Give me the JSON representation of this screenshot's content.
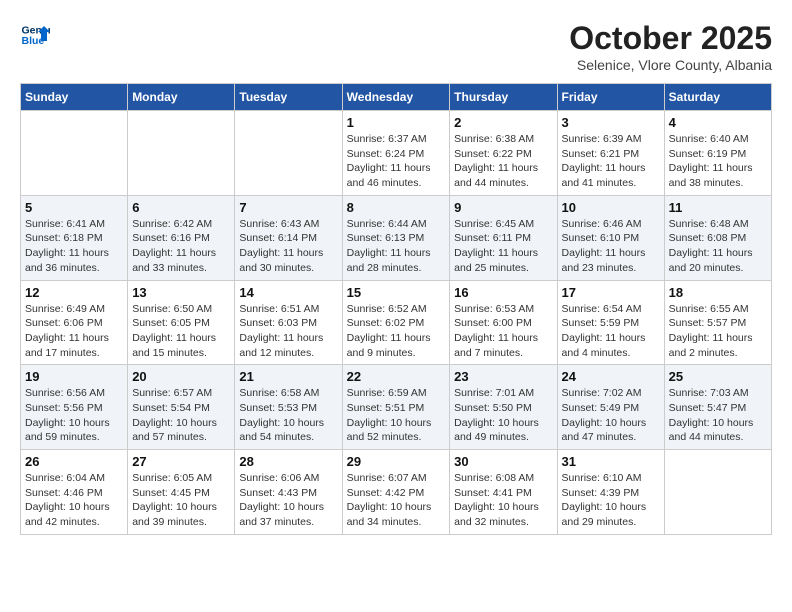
{
  "header": {
    "logo_line1": "General",
    "logo_line2": "Blue",
    "month_title": "October 2025",
    "location": "Selenice, Vlore County, Albania"
  },
  "days_of_week": [
    "Sunday",
    "Monday",
    "Tuesday",
    "Wednesday",
    "Thursday",
    "Friday",
    "Saturday"
  ],
  "weeks": [
    [
      {
        "day": "",
        "info": ""
      },
      {
        "day": "",
        "info": ""
      },
      {
        "day": "",
        "info": ""
      },
      {
        "day": "1",
        "info": "Sunrise: 6:37 AM\nSunset: 6:24 PM\nDaylight: 11 hours\nand 46 minutes."
      },
      {
        "day": "2",
        "info": "Sunrise: 6:38 AM\nSunset: 6:22 PM\nDaylight: 11 hours\nand 44 minutes."
      },
      {
        "day": "3",
        "info": "Sunrise: 6:39 AM\nSunset: 6:21 PM\nDaylight: 11 hours\nand 41 minutes."
      },
      {
        "day": "4",
        "info": "Sunrise: 6:40 AM\nSunset: 6:19 PM\nDaylight: 11 hours\nand 38 minutes."
      }
    ],
    [
      {
        "day": "5",
        "info": "Sunrise: 6:41 AM\nSunset: 6:18 PM\nDaylight: 11 hours\nand 36 minutes."
      },
      {
        "day": "6",
        "info": "Sunrise: 6:42 AM\nSunset: 6:16 PM\nDaylight: 11 hours\nand 33 minutes."
      },
      {
        "day": "7",
        "info": "Sunrise: 6:43 AM\nSunset: 6:14 PM\nDaylight: 11 hours\nand 30 minutes."
      },
      {
        "day": "8",
        "info": "Sunrise: 6:44 AM\nSunset: 6:13 PM\nDaylight: 11 hours\nand 28 minutes."
      },
      {
        "day": "9",
        "info": "Sunrise: 6:45 AM\nSunset: 6:11 PM\nDaylight: 11 hours\nand 25 minutes."
      },
      {
        "day": "10",
        "info": "Sunrise: 6:46 AM\nSunset: 6:10 PM\nDaylight: 11 hours\nand 23 minutes."
      },
      {
        "day": "11",
        "info": "Sunrise: 6:48 AM\nSunset: 6:08 PM\nDaylight: 11 hours\nand 20 minutes."
      }
    ],
    [
      {
        "day": "12",
        "info": "Sunrise: 6:49 AM\nSunset: 6:06 PM\nDaylight: 11 hours\nand 17 minutes."
      },
      {
        "day": "13",
        "info": "Sunrise: 6:50 AM\nSunset: 6:05 PM\nDaylight: 11 hours\nand 15 minutes."
      },
      {
        "day": "14",
        "info": "Sunrise: 6:51 AM\nSunset: 6:03 PM\nDaylight: 11 hours\nand 12 minutes."
      },
      {
        "day": "15",
        "info": "Sunrise: 6:52 AM\nSunset: 6:02 PM\nDaylight: 11 hours\nand 9 minutes."
      },
      {
        "day": "16",
        "info": "Sunrise: 6:53 AM\nSunset: 6:00 PM\nDaylight: 11 hours\nand 7 minutes."
      },
      {
        "day": "17",
        "info": "Sunrise: 6:54 AM\nSunset: 5:59 PM\nDaylight: 11 hours\nand 4 minutes."
      },
      {
        "day": "18",
        "info": "Sunrise: 6:55 AM\nSunset: 5:57 PM\nDaylight: 11 hours\nand 2 minutes."
      }
    ],
    [
      {
        "day": "19",
        "info": "Sunrise: 6:56 AM\nSunset: 5:56 PM\nDaylight: 10 hours\nand 59 minutes."
      },
      {
        "day": "20",
        "info": "Sunrise: 6:57 AM\nSunset: 5:54 PM\nDaylight: 10 hours\nand 57 minutes."
      },
      {
        "day": "21",
        "info": "Sunrise: 6:58 AM\nSunset: 5:53 PM\nDaylight: 10 hours\nand 54 minutes."
      },
      {
        "day": "22",
        "info": "Sunrise: 6:59 AM\nSunset: 5:51 PM\nDaylight: 10 hours\nand 52 minutes."
      },
      {
        "day": "23",
        "info": "Sunrise: 7:01 AM\nSunset: 5:50 PM\nDaylight: 10 hours\nand 49 minutes."
      },
      {
        "day": "24",
        "info": "Sunrise: 7:02 AM\nSunset: 5:49 PM\nDaylight: 10 hours\nand 47 minutes."
      },
      {
        "day": "25",
        "info": "Sunrise: 7:03 AM\nSunset: 5:47 PM\nDaylight: 10 hours\nand 44 minutes."
      }
    ],
    [
      {
        "day": "26",
        "info": "Sunrise: 6:04 AM\nSunset: 4:46 PM\nDaylight: 10 hours\nand 42 minutes."
      },
      {
        "day": "27",
        "info": "Sunrise: 6:05 AM\nSunset: 4:45 PM\nDaylight: 10 hours\nand 39 minutes."
      },
      {
        "day": "28",
        "info": "Sunrise: 6:06 AM\nSunset: 4:43 PM\nDaylight: 10 hours\nand 37 minutes."
      },
      {
        "day": "29",
        "info": "Sunrise: 6:07 AM\nSunset: 4:42 PM\nDaylight: 10 hours\nand 34 minutes."
      },
      {
        "day": "30",
        "info": "Sunrise: 6:08 AM\nSunset: 4:41 PM\nDaylight: 10 hours\nand 32 minutes."
      },
      {
        "day": "31",
        "info": "Sunrise: 6:10 AM\nSunset: 4:39 PM\nDaylight: 10 hours\nand 29 minutes."
      },
      {
        "day": "",
        "info": ""
      }
    ]
  ]
}
